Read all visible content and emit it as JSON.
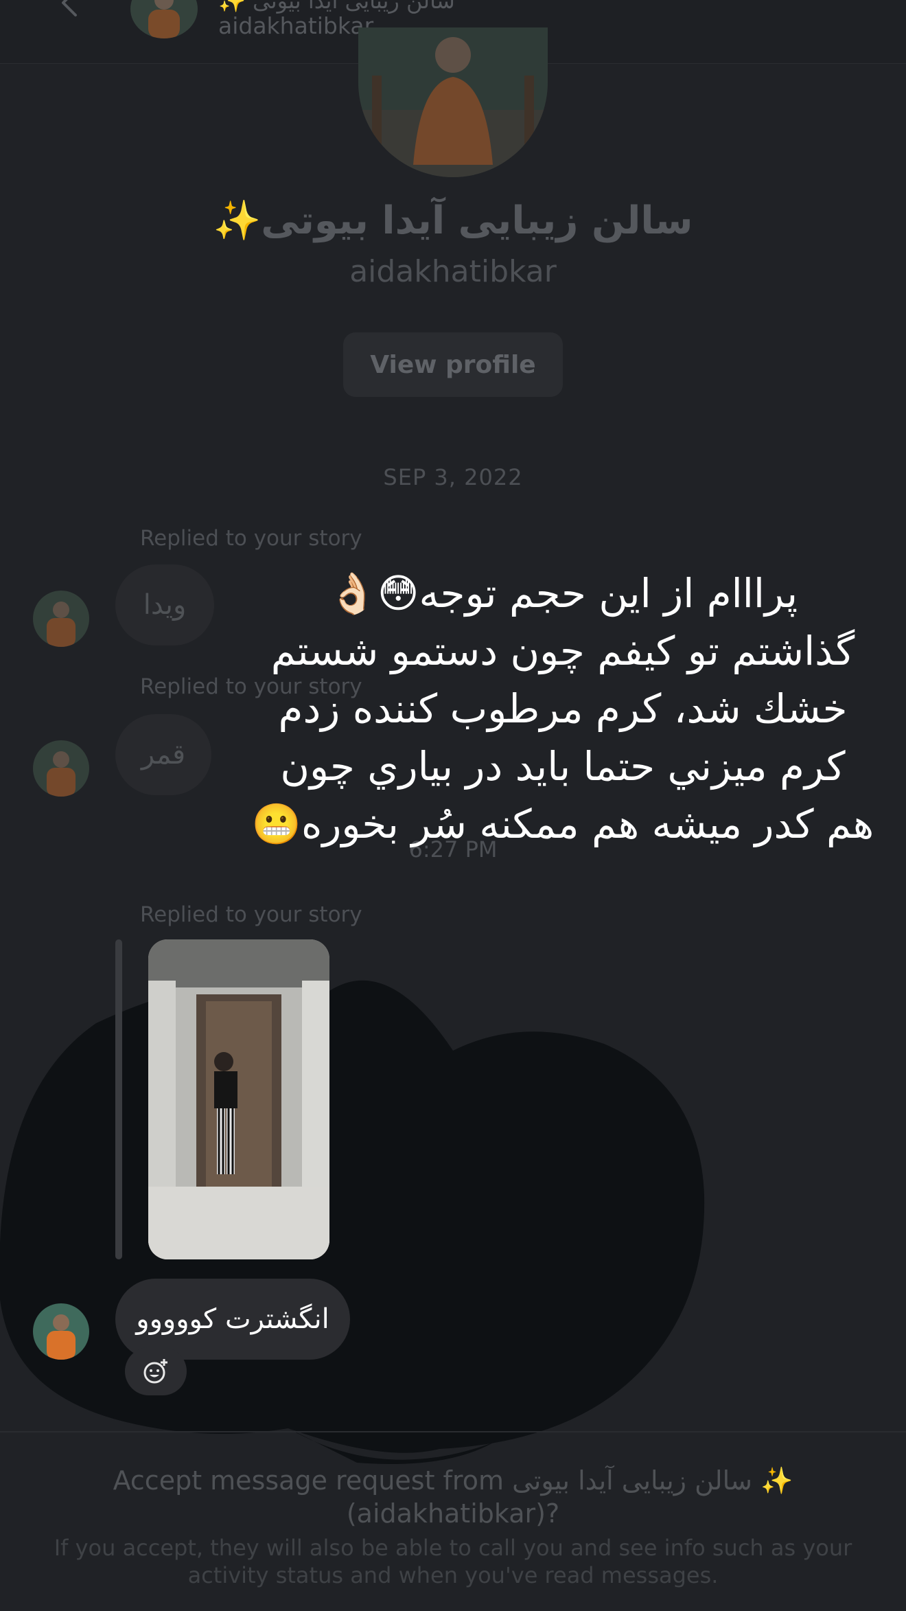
{
  "header": {
    "name": "سالن زیبایی آیدا بیوتی ✨",
    "username": "aidakhatibkar"
  },
  "profile": {
    "display_name": "سالن زیبایی آیدا بیوتی✨",
    "username": "aidakhatibkar",
    "view_profile_label": "View profile"
  },
  "date_separator": "SEP 3, 2022",
  "messages": [
    {
      "replied_label": "Replied to your story",
      "text": "ویدا"
    },
    {
      "replied_label": "Replied to your story",
      "text": "قمر"
    }
  ],
  "timestamp": "6:27 PM",
  "story_reply": {
    "replied_label": "Replied to your story",
    "text": "انگشترت کووووو"
  },
  "caption_lines": [
    "پرااام از این حجم توجه😳👌🏻",
    "گذاشتم تو کیفم چون دستمو شستم",
    "خشك شد، کرم مرطوب کننده زدم",
    "کرم میزني حتما باید در بیاري چون",
    "هم کدر میشه هم ممکنه سُر بخوره😬"
  ],
  "accept": {
    "title_prefix": "Accept message request from",
    "name": "✨ سالن زیبایی آیدا بیوتی",
    "username_line": "(aidakhatibkar)?",
    "subtitle": "If you accept, they will also be able to call you and see info such as your activity status and when you've read messages."
  }
}
